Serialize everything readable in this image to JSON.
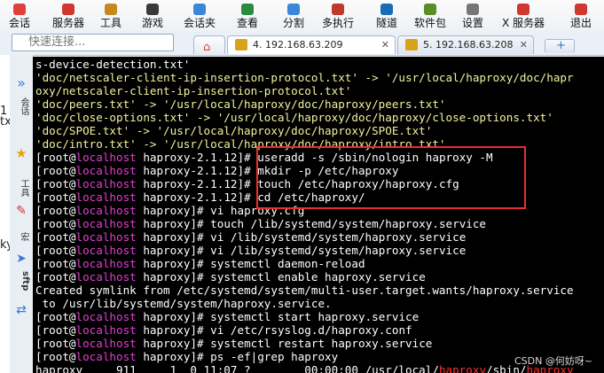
{
  "toolbar": {
    "items": [
      {
        "label": "会话",
        "icon": "session-icon",
        "color": "#e0403a"
      },
      {
        "label": "服务器",
        "icon": "server-icon",
        "color": "#d0372f"
      },
      {
        "label": "工具",
        "icon": "tools-icon",
        "color": "#c58a1f"
      },
      {
        "label": "游戏",
        "icon": "gamepad-icon",
        "color": "#3a3a3a"
      },
      {
        "label": "会话夹",
        "icon": "session-folder-icon",
        "color": "#3c86d9"
      },
      {
        "label": "查看",
        "icon": "view-icon",
        "color": "#2a8a3d"
      },
      {
        "label": "分割",
        "icon": "split-icon",
        "color": "#3c86d9"
      },
      {
        "label": "多执行",
        "icon": "multiexec-icon",
        "color": "#c0392b"
      },
      {
        "label": "隧道",
        "icon": "tunnel-icon",
        "color": "#1a6db5"
      },
      {
        "label": "软件包",
        "icon": "packages-icon",
        "color": "#5a8d2a"
      },
      {
        "label": "设置",
        "icon": "settings-icon",
        "color": "#777777"
      },
      {
        "label": "X 服务器",
        "icon": "x-server-icon",
        "color": "#d0372f"
      },
      {
        "label": "退出",
        "icon": "exit-icon",
        "color": "#d0372f"
      }
    ]
  },
  "quick_connect": {
    "placeholder": "快速连接..."
  },
  "tabs": [
    {
      "label": "4. 192.168.63.209"
    },
    {
      "label": "5. 192.168.63.208"
    }
  ],
  "sidebar": {
    "items": [
      "会话",
      "工具",
      "宏",
      "sftp"
    ]
  },
  "left_edge": {
    "labels": [
      "1",
      "txt",
      "ky"
    ]
  },
  "terminal": {
    "lines": [
      [
        {
          "t": "s-device-detection.txt'",
          "c": "w"
        }
      ],
      [
        {
          "t": "'doc/netscaler-client-ip-insertion-protocol.txt' -> '/usr/local/haproxy/doc/hapr",
          "c": "y"
        }
      ],
      [
        {
          "t": "oxy/netscaler-client-ip-insertion-protocol.txt'",
          "c": "y"
        }
      ],
      [
        {
          "t": "'doc/peers.txt' -> '/usr/local/haproxy/doc/haproxy/peers.txt'",
          "c": "y"
        }
      ],
      [
        {
          "t": "'doc/close-options.txt' -> '/usr/local/haproxy/doc/haproxy/close-options.txt'",
          "c": "y"
        }
      ],
      [
        {
          "t": "'doc/SPOE.txt' -> '/usr/local/haproxy/doc/haproxy/SPOE.txt'",
          "c": "y"
        }
      ],
      [
        {
          "t": "'doc/intro.txt' -> '/usr/local/haproxy/doc/haproxy/intro.txt'",
          "c": "y"
        }
      ],
      [
        {
          "t": "[root@",
          "c": "w"
        },
        {
          "t": "localhost",
          "c": "m"
        },
        {
          "t": " haproxy-2.1.12]# useradd -s /sbin/nologin haproxy -M",
          "c": "w"
        }
      ],
      [
        {
          "t": "[root@",
          "c": "w"
        },
        {
          "t": "localhost",
          "c": "m"
        },
        {
          "t": " haproxy-2.1.12]# mkdir -p /etc/haproxy",
          "c": "w"
        }
      ],
      [
        {
          "t": "[root@",
          "c": "w"
        },
        {
          "t": "localhost",
          "c": "m"
        },
        {
          "t": " haproxy-2.1.12]# touch /etc/haproxy/haproxy.cfg",
          "c": "w"
        }
      ],
      [
        {
          "t": "[root@",
          "c": "w"
        },
        {
          "t": "localhost",
          "c": "m"
        },
        {
          "t": " haproxy-2.1.12]# cd /etc/haproxy/",
          "c": "w"
        }
      ],
      [
        {
          "t": "[root@",
          "c": "w"
        },
        {
          "t": "localhost",
          "c": "m"
        },
        {
          "t": " haproxy]# vi haproxy.cfg",
          "c": "w"
        }
      ],
      [
        {
          "t": "[root@",
          "c": "w"
        },
        {
          "t": "localhost",
          "c": "m"
        },
        {
          "t": " haproxy]# touch /lib/systemd/system/haproxy.service",
          "c": "w"
        }
      ],
      [
        {
          "t": "[root@",
          "c": "w"
        },
        {
          "t": "localhost",
          "c": "m"
        },
        {
          "t": " haproxy]# vi /lib/systemd/system/haproxy.service",
          "c": "w"
        }
      ],
      [
        {
          "t": "[root@",
          "c": "w"
        },
        {
          "t": "localhost",
          "c": "m"
        },
        {
          "t": " haproxy]# vi /lib/systemd/system/haproxy.service",
          "c": "w"
        }
      ],
      [
        {
          "t": "[root@",
          "c": "w"
        },
        {
          "t": "localhost",
          "c": "m"
        },
        {
          "t": " haproxy]# systemctl daemon-reload",
          "c": "w"
        }
      ],
      [
        {
          "t": "[root@",
          "c": "w"
        },
        {
          "t": "localhost",
          "c": "m"
        },
        {
          "t": " haproxy]# systemctl enable haproxy.service",
          "c": "w"
        }
      ],
      [
        {
          "t": "Created symlink from /etc/systemd/system/multi-user.target.wants/haproxy.service",
          "c": "w"
        }
      ],
      [
        {
          "t": " to /usr/lib/systemd/system/haproxy.service.",
          "c": "w"
        }
      ],
      [
        {
          "t": "[root@",
          "c": "w"
        },
        {
          "t": "localhost",
          "c": "m"
        },
        {
          "t": " haproxy]# systemctl start haproxy.service",
          "c": "w"
        }
      ],
      [
        {
          "t": "[root@",
          "c": "w"
        },
        {
          "t": "localhost",
          "c": "m"
        },
        {
          "t": " haproxy]# vi /etc/rsyslog.d/haproxy.conf",
          "c": "w"
        }
      ],
      [
        {
          "t": "[root@",
          "c": "w"
        },
        {
          "t": "localhost",
          "c": "m"
        },
        {
          "t": " haproxy]# systemctl restart haproxy.service",
          "c": "w"
        }
      ],
      [
        {
          "t": "[root@",
          "c": "w"
        },
        {
          "t": "localhost",
          "c": "m"
        },
        {
          "t": " haproxy]# ps -ef|grep haproxy",
          "c": "w"
        }
      ],
      [
        {
          "t": "haproxy     911     1  0 11:07 ?        00:00:00 /usr/local/",
          "c": "w"
        },
        {
          "t": "haproxy",
          "c": "r"
        },
        {
          "t": "/sbin/",
          "c": "w"
        },
        {
          "t": "haproxy",
          "c": "r"
        }
      ]
    ]
  },
  "watermark": "CSDN @何妨呀~"
}
